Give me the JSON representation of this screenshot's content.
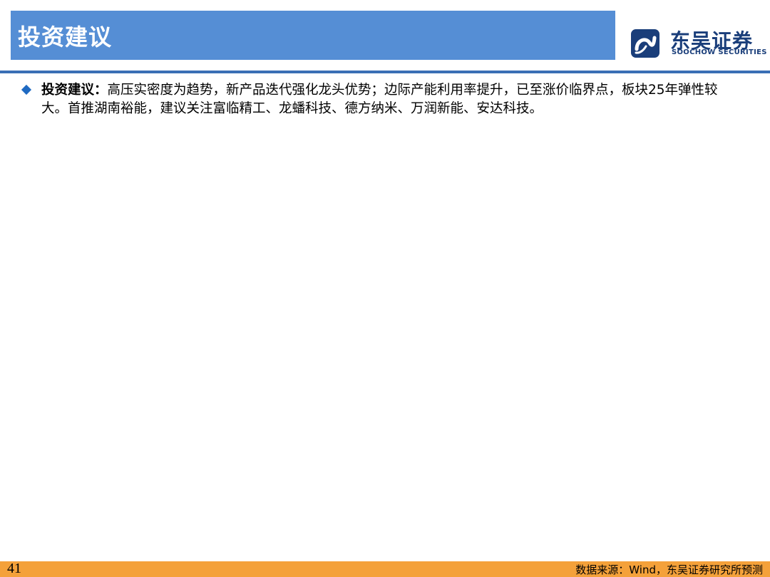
{
  "header": {
    "title": "投资建议",
    "title_bar_color": "#558ed5",
    "rule_color": "#3a6fb5"
  },
  "logo": {
    "cn_name": "东吴证券",
    "en_name": "SOOCHOW SECURITIES",
    "icon": "soochow-logo-icon",
    "color": "#1a3e7a"
  },
  "body": {
    "bullet_icon": "diamond-bullet-icon",
    "bullet_color": "#1f6ac2",
    "label": "投资建议：",
    "text": "高压实密度为趋势，新产品迭代强化龙头优势；边际产能利用率提升，已至涨价临界点，板块25年弹性较大。首推湖南裕能，建议关注富临精工、龙蟠科技、德方纳米、万润新能、安达科技。"
  },
  "footer": {
    "page_number": "41",
    "source": "数据来源：Wind，东吴证券研究所预测",
    "bar_color": "#f4a13a"
  }
}
